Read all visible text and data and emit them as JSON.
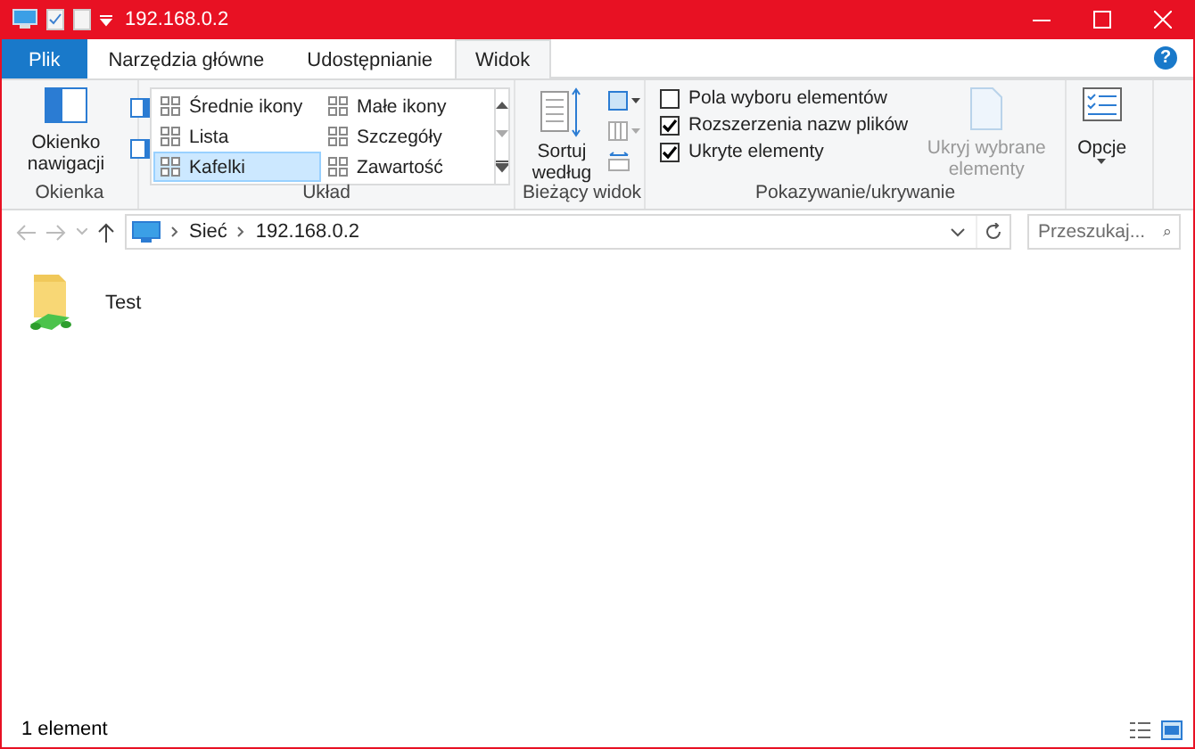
{
  "window": {
    "title": "192.168.0.2"
  },
  "tabs": [
    {
      "label": "Plik",
      "kind": "file",
      "selected": false
    },
    {
      "label": "Narzędzia główne",
      "kind": "tab",
      "selected": false
    },
    {
      "label": "Udostępnianie",
      "kind": "tab",
      "selected": false
    },
    {
      "label": "Widok",
      "kind": "tab",
      "selected": true
    }
  ],
  "help_button": "?",
  "ribbon": {
    "panes": {
      "label": "Okienka",
      "navigation_pane": "Okienko nawigacji"
    },
    "layout": {
      "label": "Układ",
      "options": [
        {
          "label": "Średnie ikony",
          "selected": false
        },
        {
          "label": "Małe ikony",
          "selected": false
        },
        {
          "label": "Lista",
          "selected": false
        },
        {
          "label": "Szczegóły",
          "selected": false
        },
        {
          "label": "Kafelki",
          "selected": true
        },
        {
          "label": "Zawartość",
          "selected": false
        }
      ]
    },
    "current_view": {
      "label": "Bieżący widok",
      "sort_button": "Sortuj według"
    },
    "show_hide": {
      "label": "Pokazywanie/ukrywanie",
      "checkboxes": [
        {
          "label": "Pola wyboru elementów",
          "checked": false
        },
        {
          "label": "Rozszerzenia nazw plików",
          "checked": true
        },
        {
          "label": "Ukryte elementy",
          "checked": true
        }
      ],
      "hide_selected": {
        "label": "Ukryj wybrane elementy",
        "disabled": true
      }
    },
    "options_button": "Opcje"
  },
  "address_bar": {
    "path": [
      "Sieć",
      "192.168.0.2"
    ]
  },
  "search": {
    "placeholder": "Przeszukaj..."
  },
  "items": [
    {
      "name": "Test"
    }
  ],
  "status_bar": {
    "text": "1 element"
  }
}
